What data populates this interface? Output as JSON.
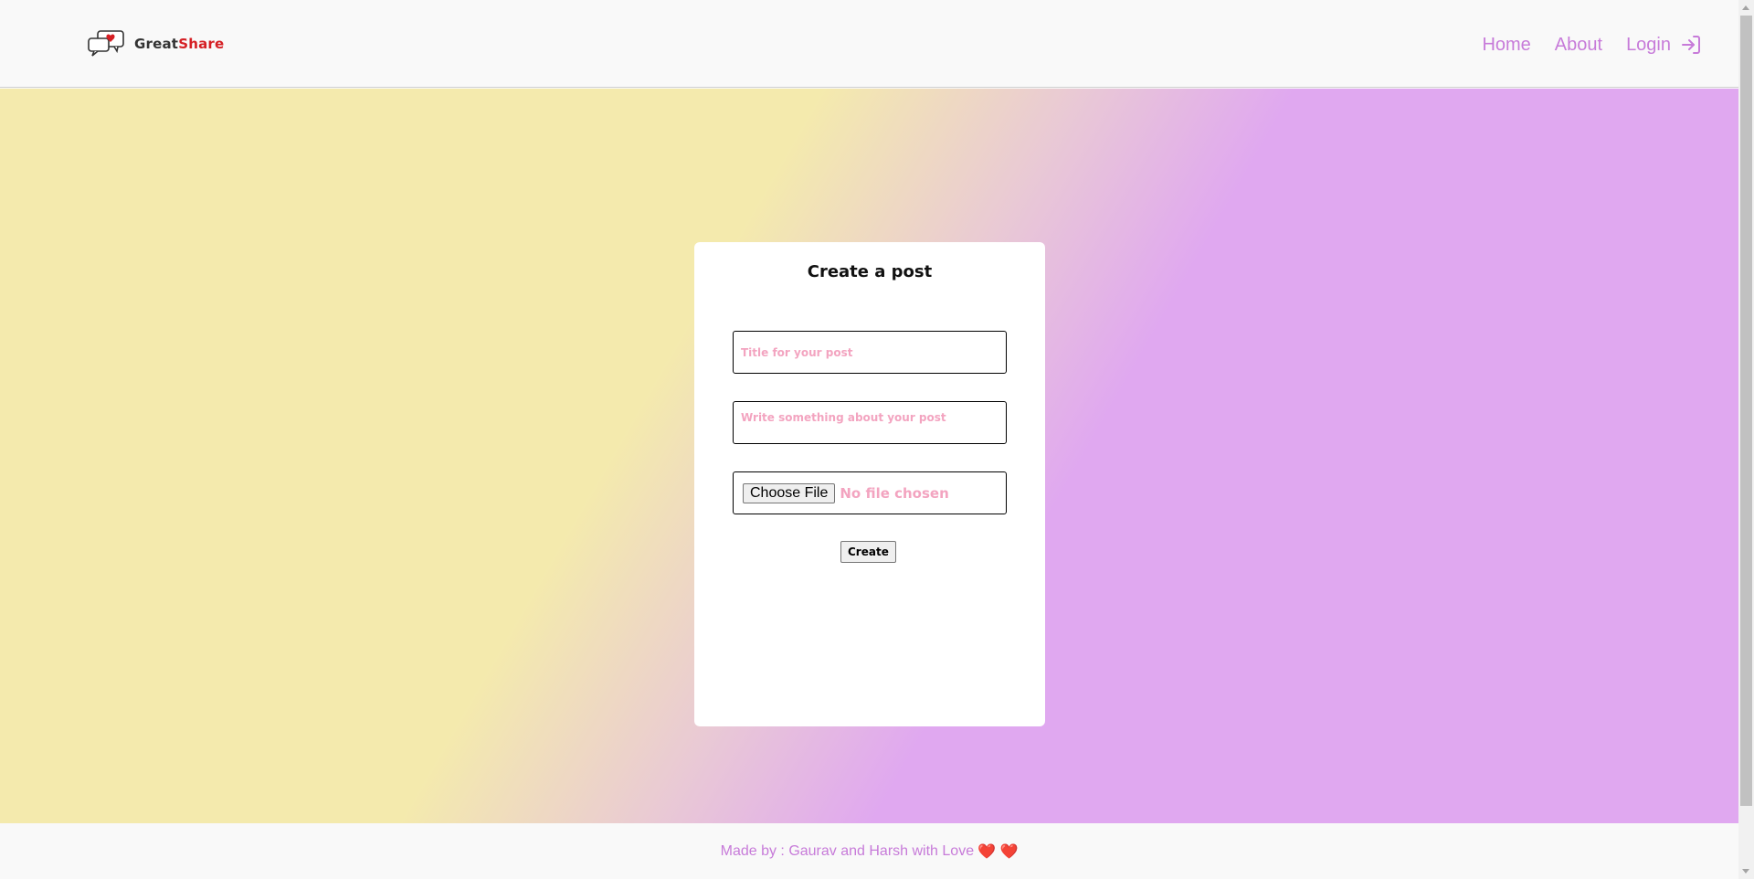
{
  "logo": {
    "part1": "Great",
    "part2": "Share",
    "icon": "chat-bubble-heart-icon",
    "colors": {
      "part1": "#333333",
      "part2": "#d51f24"
    }
  },
  "nav": {
    "home_label": "Home",
    "about_label": "About",
    "login_label": "Login",
    "login_icon": "login-arrow-icon",
    "link_color": "#c77bd9"
  },
  "form": {
    "title": "Create a post",
    "title_placeholder": "Title for your post",
    "description_placeholder": "Write something about your post",
    "file_button_label": "Choose File",
    "file_status": "No file chosen",
    "submit_label": "Create",
    "placeholder_color": "#f3a4c0"
  },
  "footer": {
    "text": "Made by : Gaurav and Harsh with Love",
    "hearts": "❤️ ❤️"
  },
  "theme": {
    "gradient_start": "#f4eaad",
    "gradient_end": "#e0a8f0"
  }
}
